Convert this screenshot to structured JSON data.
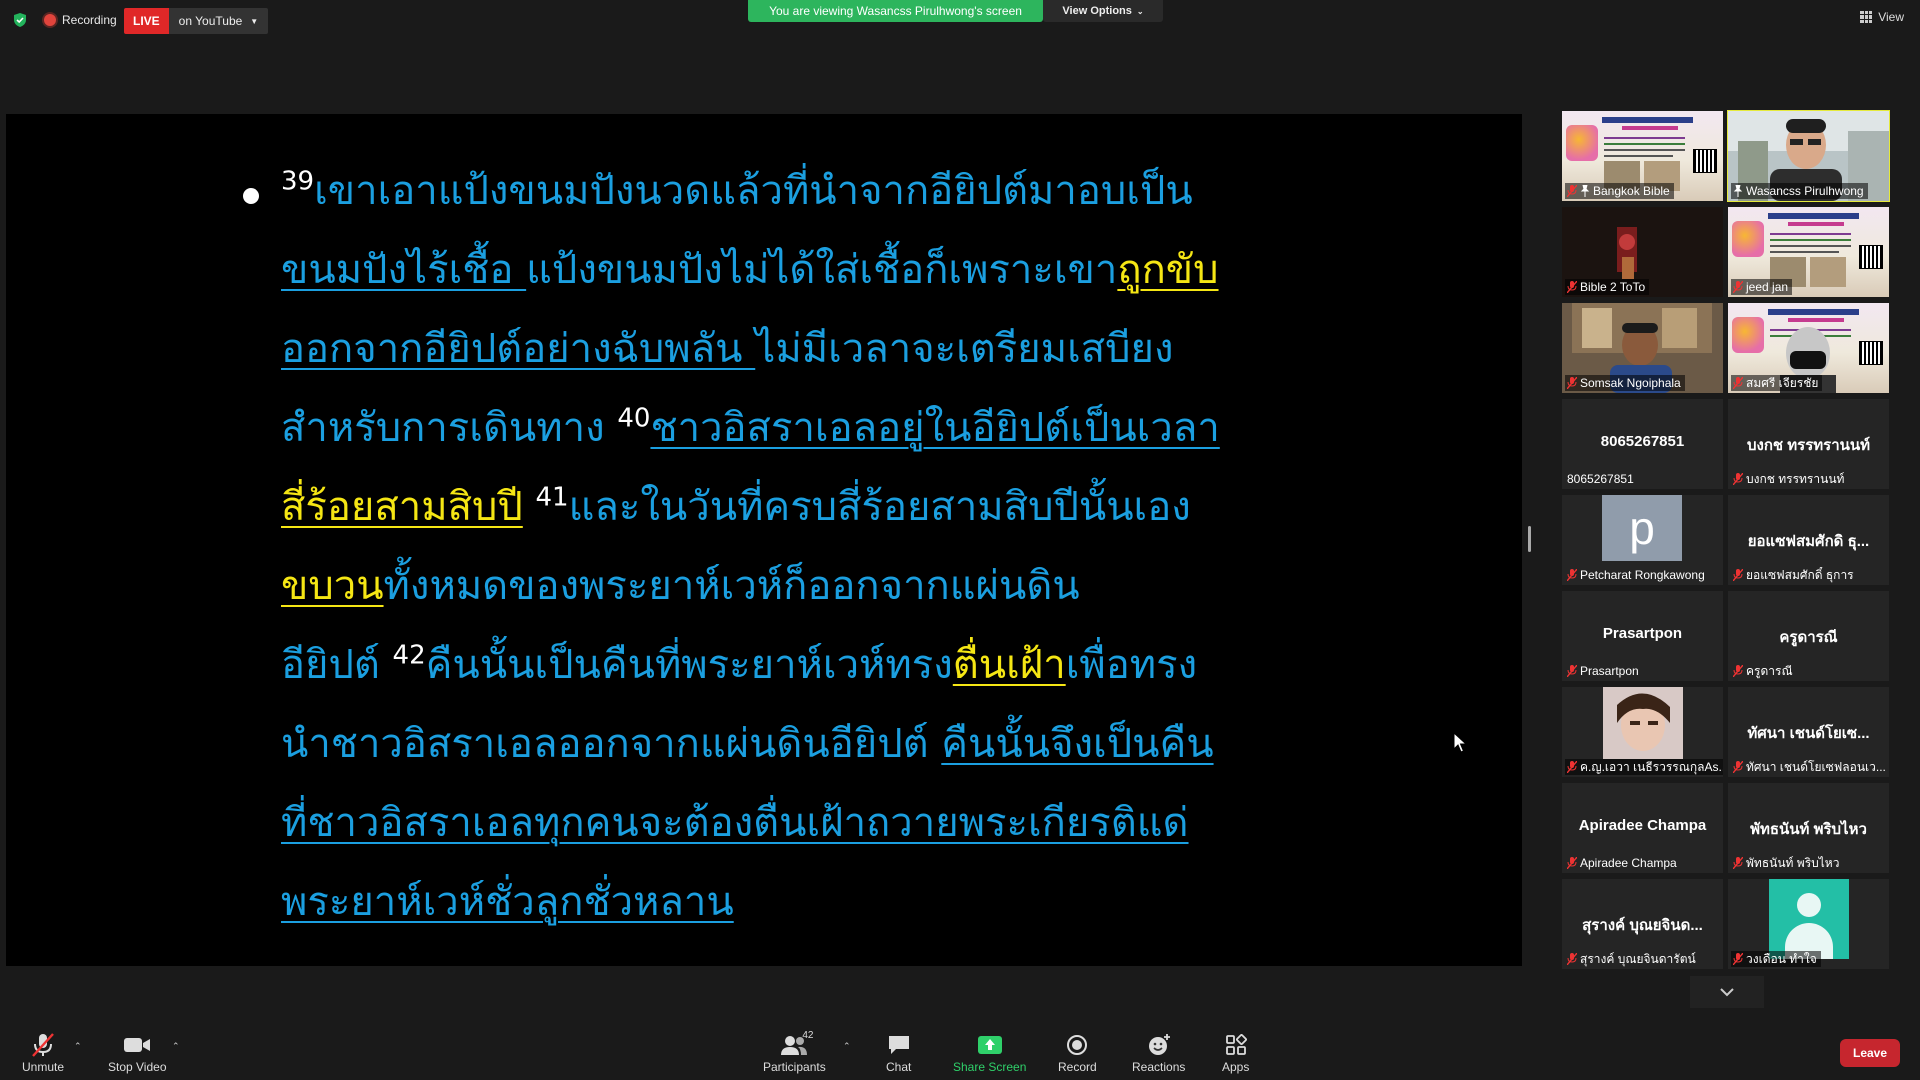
{
  "topbar": {
    "recording_label": "Recording",
    "live_label": "LIVE",
    "stream_target": "on YouTube",
    "viewing_banner": "You are viewing Wasancss Pirulhwong's screen",
    "view_options": "View Options",
    "view_label": "View"
  },
  "slide": {
    "lines": [
      {
        "sup": "39",
        "t1": "เขาเอาแป้งขนมปังนวดแล้วที่นำจากอียิปต์มาอบเป็น"
      },
      {
        "u1": "ขนมปังไร้เชื้อ ",
        "t1": "แป้งขนมปังไม่ได้ใส่เชื้อก็เพราะเขา",
        "y1": "ถูกขับ"
      },
      {
        "u1": "ออกจากอียิปต์อย่างฉับพลัน ",
        "t1": "ไม่มีเวลาจะเตรียมเสบียง"
      },
      {
        "t1": "สำหรับการเดินทาง ",
        "sup": "40",
        "u1": "ชาวอิสราเอลอยู่ในอียิปต์เป็นเวลา"
      },
      {
        "y1": "สี่ร้อยสามสิบปี",
        "sup": "41",
        "t1": "และในวันที่ครบสี่ร้อยสามสิบปีนั้นเอง"
      },
      {
        "y1": "ขบวน",
        "t1": "ทั้งหมดของพระยาห์เวห์ก็ออกจากแผ่นดิน"
      },
      {
        "t1": "อียิปต์ ",
        "sup": "42",
        "t2": "คืนนั้นเป็นคืนที่พระยาห์เวห์ทรง",
        "y1": "ตื่นเฝ้า",
        "t3": "เพื่อทรง"
      },
      {
        "t1": "นำชาวอิสราเอลออกจากแผ่นดินอียิปต์ ",
        "u1": "คืนนั้นจึงเป็นคืน"
      },
      {
        "u1": "ที่ชาวอิสราเอลทุกคนจะต้องตื่นเฝ้าถวายพระเกียรติแด่"
      },
      {
        "u1": "พระยาห์เวห์ชั่วลูกชั่วหลาน"
      }
    ]
  },
  "gallery": {
    "tiles": [
      {
        "name": "Bangkok Bible",
        "kind": "poster"
      },
      {
        "name": "Wasancss Pirulhwong",
        "kind": "camera-man",
        "active": true
      },
      {
        "name": "Bible 2 ToTo",
        "kind": "dark"
      },
      {
        "name": "jeed jan",
        "kind": "poster"
      },
      {
        "name": "Somsak Ngoiphala",
        "kind": "camera-room"
      },
      {
        "name": "สมศรี เจียรชัย",
        "kind": "poster-mask"
      },
      {
        "name": "8065267851",
        "big": "8065267851",
        "kind": "name"
      },
      {
        "name": "บงกช ทรรทรานนท์",
        "big": "บงกช ทรรทรานนท์",
        "kind": "name"
      },
      {
        "name": "Petcharat Rongkawong",
        "letter": "p",
        "kind": "letter"
      },
      {
        "name": "ยอแซฟสมศักดิ์ ธุการ",
        "big": "ยอแซฟสมศักดิ ธุ...",
        "kind": "name"
      },
      {
        "name": "Prasartpon",
        "big": "Prasartpon",
        "kind": "name"
      },
      {
        "name": "ครูดารณี",
        "big": "ครูดารณี",
        "kind": "name"
      },
      {
        "name": "ค.ญ.เอวา เนธีรวรรณกุลAs...",
        "kind": "camera-woman"
      },
      {
        "name": "ทัศนา เชนด์โยเซฟลอนเว...",
        "big": "ทัศนา เชนด์โยเซ...",
        "kind": "name"
      },
      {
        "name": "Apiradee Champa",
        "big": "Apiradee Champa",
        "kind": "name"
      },
      {
        "name": "พัทธนันท์ พริบไหว",
        "big": "พัทธนันท์ พริบไหว",
        "kind": "name"
      },
      {
        "name": "สุรางค์ บุณยจินดารัตน์",
        "big": "สุรางค์ บุณยจินด...",
        "kind": "name"
      },
      {
        "name": "วงเดือน ทำใจ",
        "kind": "avatar"
      }
    ]
  },
  "toolbar": {
    "unmute": "Unmute",
    "stop_video": "Stop Video",
    "participants": "Participants",
    "participant_count": "42",
    "chat": "Chat",
    "share_screen": "Share Screen",
    "record": "Record",
    "reactions": "Reactions",
    "apps": "Apps",
    "leave": "Leave"
  },
  "colors": {
    "slide_text": "#1b9fe0",
    "highlight": "#f5e614",
    "banner_green": "#2db55d",
    "live_red": "#e02828",
    "leave_red": "#c6262e",
    "active_speaker": "#e5ea3c"
  }
}
